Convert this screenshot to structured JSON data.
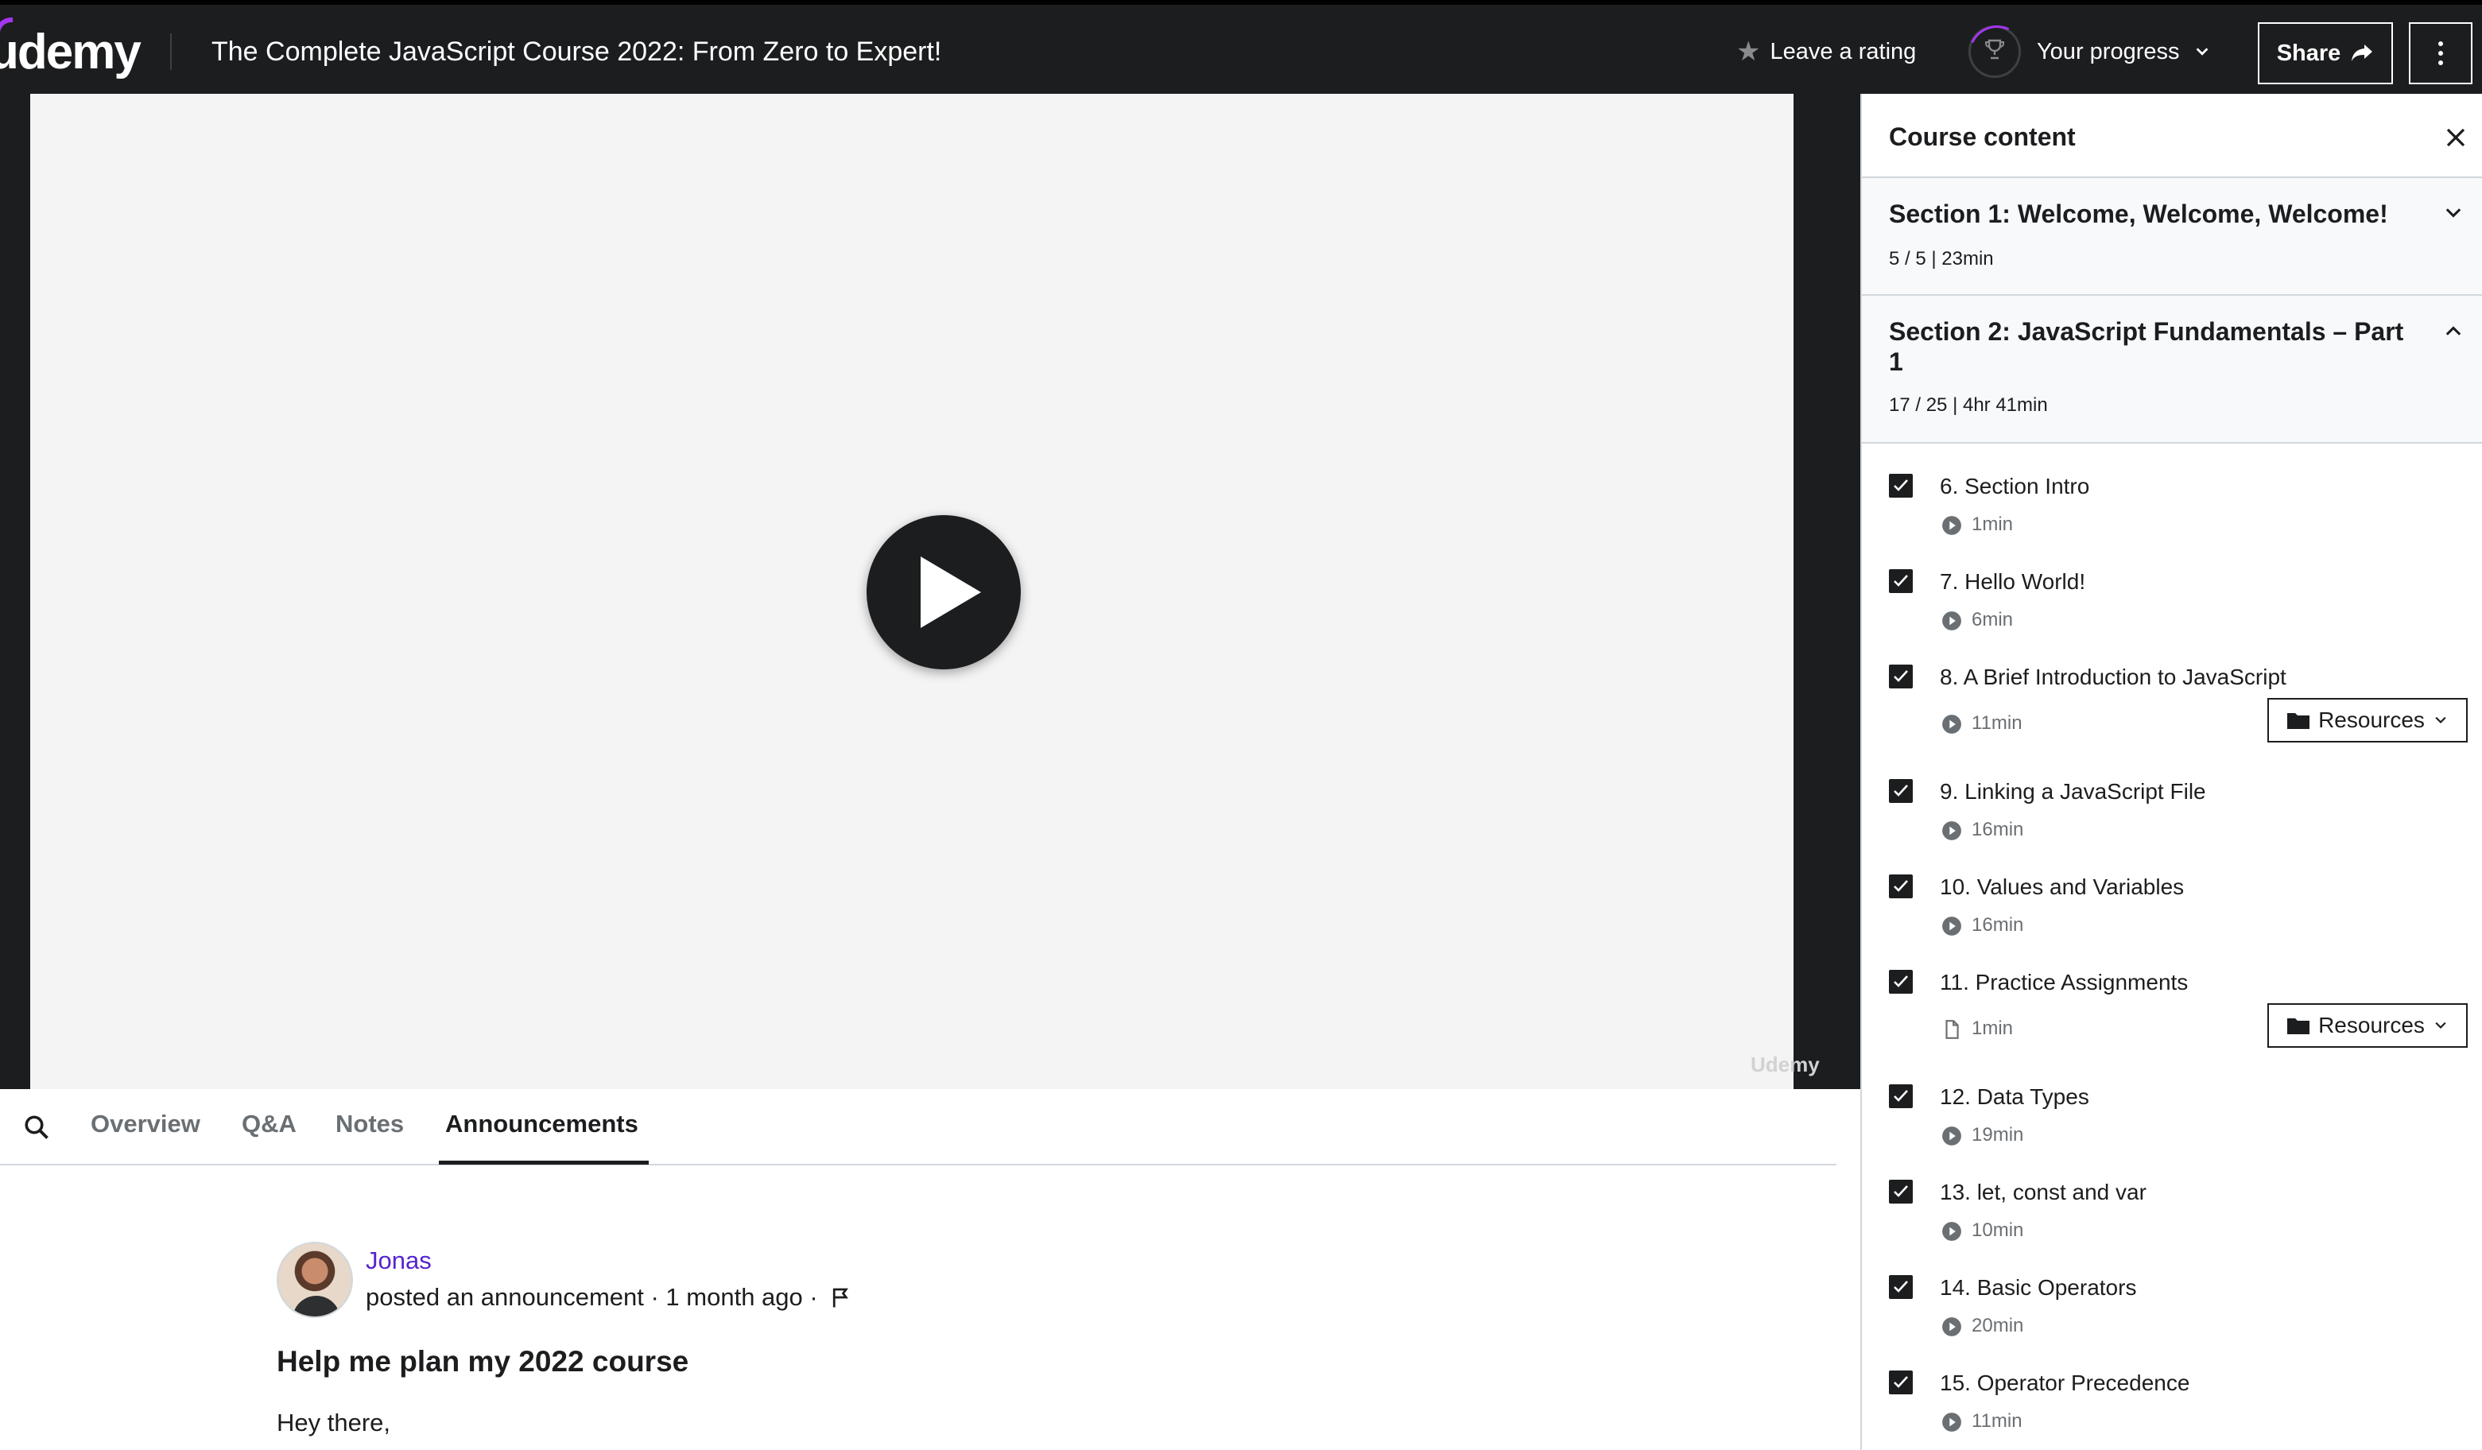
{
  "header": {
    "logo": "udemy",
    "course_title": "The Complete JavaScript Course 2022: From Zero to Expert!",
    "leave_rating": "Leave a rating",
    "your_progress": "Your progress",
    "share": "Share"
  },
  "video": {
    "watermark": "Udemy"
  },
  "tabs": [
    "Overview",
    "Q&A",
    "Notes",
    "Announcements"
  ],
  "announcement": {
    "author": "Jonas",
    "meta": "posted an announcement · 1 month ago ·",
    "title": "Help me plan my 2022 course",
    "body": "Hey there,"
  },
  "sidebar": {
    "title": "Course content",
    "sections": [
      {
        "title": "Section 1: Welcome, Welcome, Welcome!",
        "meta": "5 / 5 | 23min"
      },
      {
        "title": "Section 2: JavaScript Fundamentals – Part 1",
        "meta": "17 / 25 | 4hr 41min"
      }
    ],
    "lectures": [
      {
        "title": "6. Section Intro",
        "duration": "1min",
        "type": "video"
      },
      {
        "title": "7. Hello World!",
        "duration": "6min",
        "type": "video"
      },
      {
        "title": "8. A Brief Introduction to JavaScript",
        "duration": "11min",
        "type": "video",
        "resources": "Resources"
      },
      {
        "title": "9. Linking a JavaScript File",
        "duration": "16min",
        "type": "video"
      },
      {
        "title": "10. Values and Variables",
        "duration": "16min",
        "type": "video"
      },
      {
        "title": "11. Practice Assignments",
        "duration": "1min",
        "type": "file",
        "resources": "Resources"
      },
      {
        "title": "12. Data Types",
        "duration": "19min",
        "type": "video"
      },
      {
        "title": "13. let, const and var",
        "duration": "10min",
        "type": "video"
      },
      {
        "title": "14. Basic Operators",
        "duration": "20min",
        "type": "video"
      },
      {
        "title": "15. Operator Precedence",
        "duration": "11min",
        "type": "video"
      }
    ]
  }
}
